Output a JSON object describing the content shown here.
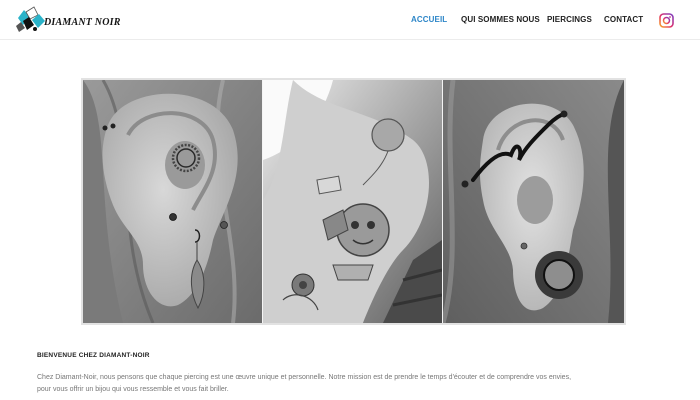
{
  "brand": {
    "name": "DIAMANT NOIR"
  },
  "nav": {
    "items": [
      {
        "label": "ACCUEIL",
        "active": true
      },
      {
        "label": "QUI SOMMES NOUS",
        "active": false
      },
      {
        "label": "PIERCINGS",
        "active": false
      },
      {
        "label": "CONTACT",
        "active": false
      }
    ],
    "social_icon": "instagram-icon"
  },
  "hero": {
    "panels": [
      "ear-piercings-photo",
      "tattooed-arm-photo",
      "stretched-lobe-photo"
    ]
  },
  "content": {
    "heading": "BIENVENUE CHEZ DIAMANT-NOIR",
    "intro_line1": "Chez Diamant-Noir, nous pensons que chaque piercing est une œuvre unique et personnelle. Notre mission est de prendre le temps d'écouter et de comprendre vos envies,",
    "intro_line2": "pour vous offrir un bijou qui vous ressemble et vous fait briller."
  },
  "colors": {
    "accent": "#2d86c8",
    "text_dark": "#222222",
    "text_body": "#777777"
  }
}
